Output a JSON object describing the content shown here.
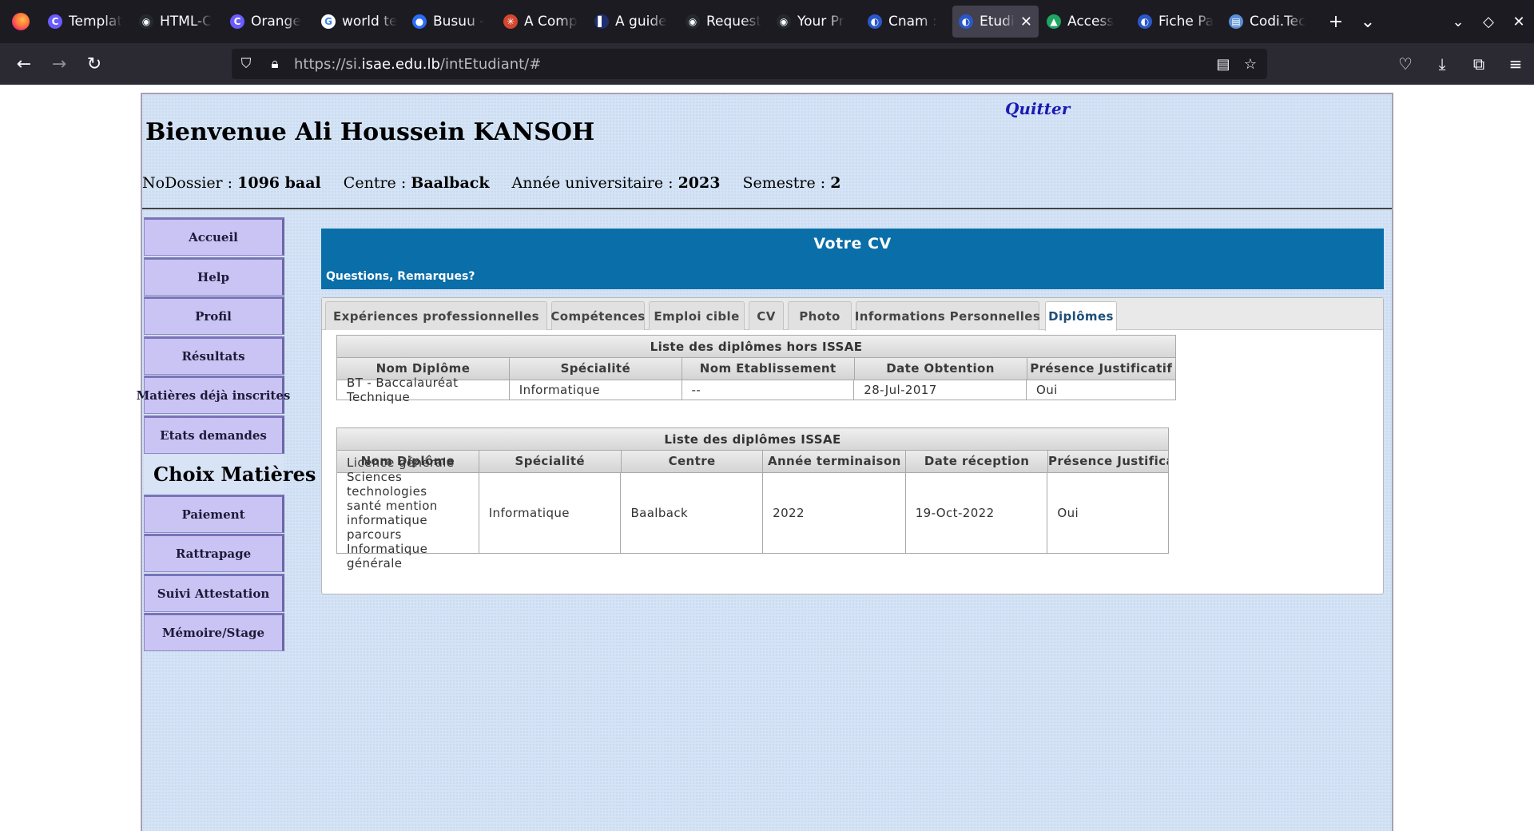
{
  "browser": {
    "tabs": [
      {
        "title": "Templat",
        "color": "#6a5cff",
        "glyph": "C"
      },
      {
        "title": "HTML-C",
        "color": "#24292f",
        "glyph": "◉"
      },
      {
        "title": "Orange",
        "color": "#6a5cff",
        "glyph": "C"
      },
      {
        "title": "world te",
        "color": "#ffffff",
        "glyph": "G"
      },
      {
        "title": "Busuu -",
        "color": "#2d6cf6",
        "glyph": "●"
      },
      {
        "title": "A Comp",
        "color": "#d4472e",
        "glyph": "✳"
      },
      {
        "title": "A guide",
        "color": "#1f2f6e",
        "glyph": "▌"
      },
      {
        "title": "Request",
        "color": "#24292f",
        "glyph": "◉"
      },
      {
        "title": "Your Pr",
        "color": "#24292f",
        "glyph": "◉"
      },
      {
        "title": "Cnam :",
        "color": "#2a58c9",
        "glyph": "◐"
      },
      {
        "title": "Etudi",
        "color": "#2a58c9",
        "glyph": "◐"
      },
      {
        "title": "Access",
        "color": "#1fa463",
        "glyph": "▲"
      },
      {
        "title": "Fiche Pa",
        "color": "#2a58c9",
        "glyph": "◐"
      },
      {
        "title": "Codi.Tec",
        "color": "#5b8fd6",
        "glyph": "▤"
      }
    ],
    "active_tab_index": 10,
    "url_prefix": "https://si.",
    "url_domain": "isae.edu.lb",
    "url_path": "/intEtudiant/#"
  },
  "header": {
    "quit_label": "Quitter",
    "welcome": "Bienvenue Ali Houssein KANSOH",
    "dossier_label": "NoDossier : ",
    "dossier_value": "1096 baal",
    "centre_label": "Centre : ",
    "centre_value": "Baalback",
    "annee_label": "Année universitaire : ",
    "annee_value": "2023",
    "semestre_label": "Semestre : ",
    "semestre_value": "2"
  },
  "sidebar": {
    "items": [
      "Accueil",
      "Help",
      "Profil",
      "Résultats",
      "Matières déjà inscrites",
      "Etats demandes",
      "Choix Matières",
      "Paiement",
      "Rattrapage",
      "Suivi Attestation",
      "Mémoire/Stage"
    ]
  },
  "panel": {
    "title": "Votre CV",
    "subtitle": "Questions, Remarques?",
    "tabs": [
      "Expériences professionnelles",
      "Compétences",
      "Emploi cible",
      "CV",
      "Photo",
      "Informations Personnelles",
      "Diplômes"
    ],
    "active_tab": "Diplômes"
  },
  "table_hors": {
    "caption": "Liste des diplômes hors ISSAE",
    "headers": [
      "Nom Diplôme",
      "Spécialité",
      "Nom Etablissement",
      "Date Obtention",
      "Présence Justificatif"
    ],
    "rows": [
      [
        "BT - Baccalauréat Technique",
        "Informatique",
        "--",
        "28-Jul-2017",
        "Oui"
      ]
    ]
  },
  "table_issae": {
    "caption": "Liste des diplômes ISSAE",
    "headers": [
      "Nom Diplôme",
      "Spécialité",
      "Centre",
      "Année terminaison",
      "Date réception",
      "Présence Justificatif"
    ],
    "rows": [
      [
        "Licence générale\nSciences technologies\nsanté mention\ninformatique parcours\nInformatique générale",
        "Informatique",
        "Baalback",
        "2022",
        "19-Oct-2022",
        "Oui"
      ]
    ]
  }
}
